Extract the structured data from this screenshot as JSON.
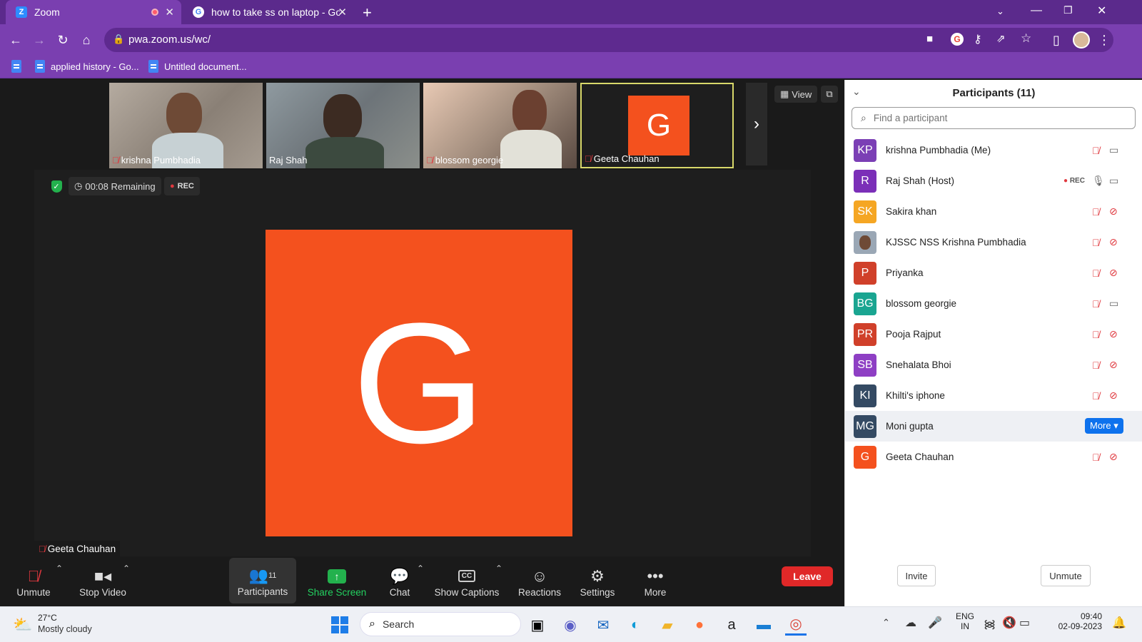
{
  "browser": {
    "tabs": [
      {
        "title": "Zoom",
        "favicon": "Z",
        "active": true
      },
      {
        "title": "how to take ss on laptop - Googl",
        "favicon": "G",
        "active": false
      }
    ],
    "new_tab": "+",
    "url": "pwa.zoom.us/wc/",
    "bookmarks": [
      "applied history - Go...",
      "Untitled document..."
    ]
  },
  "meeting": {
    "thumbnails": [
      {
        "name": "krishna Pumbhadia",
        "muted": true
      },
      {
        "name": "Raj Shah",
        "muted": false
      },
      {
        "name": "blossom georgie",
        "muted": true
      },
      {
        "name": "Geeta Chauhan",
        "muted": true,
        "initial": "G"
      }
    ],
    "view_label": "View",
    "timer": "00:08 Remaining",
    "rec": "REC",
    "main_initial": "G",
    "speaker_name": "Geeta Chauhan",
    "brand_color": "#f4511e"
  },
  "controls": {
    "unmute": "Unmute",
    "stop_video": "Stop Video",
    "participants": "Participants",
    "participants_count": "11",
    "share_screen": "Share Screen",
    "chat": "Chat",
    "show_captions": "Show Captions",
    "reactions": "Reactions",
    "settings": "Settings",
    "more": "More",
    "leave": "Leave"
  },
  "panel": {
    "title": "Participants (11)",
    "search_placeholder": "Find a participant",
    "participants": [
      {
        "initials": "KP",
        "name": "krishna Pumbhadia (Me)",
        "color": "#7b3fb5",
        "mic": "muted",
        "video": "on"
      },
      {
        "initials": "R",
        "name": "Raj Shah (Host)",
        "color": "#7b2fb8",
        "mic": "on",
        "video": "on",
        "rec": "REC"
      },
      {
        "initials": "SK",
        "name": "Sakira khan",
        "color": "#f5a623",
        "mic": "muted",
        "video": "off"
      },
      {
        "initials": "",
        "name": "KJSSC NSS Krishna Pumbhadia",
        "color": "#9aa7b5",
        "mic": "muted",
        "video": "off",
        "photo": true
      },
      {
        "initials": "P",
        "name": "Priyanka",
        "color": "#d0402a",
        "mic": "muted",
        "video": "off"
      },
      {
        "initials": "BG",
        "name": "blossom georgie",
        "color": "#1aa591",
        "mic": "muted",
        "video": "on"
      },
      {
        "initials": "PR",
        "name": "Pooja Rajput",
        "color": "#d0402a",
        "mic": "muted",
        "video": "off"
      },
      {
        "initials": "SB",
        "name": "Snehalata Bhoi",
        "color": "#8e3fc4",
        "mic": "muted",
        "video": "off"
      },
      {
        "initials": "KI",
        "name": "Khilti's iphone",
        "color": "#344a63",
        "mic": "muted",
        "video": "off"
      },
      {
        "initials": "MG",
        "name": "Moni gupta",
        "color": "#344a63",
        "mic": "none",
        "video": "none",
        "hover": true,
        "more_label": "More ▾"
      },
      {
        "initials": "G",
        "name": "Geeta Chauhan",
        "color": "#f4511e",
        "mic": "muted",
        "video": "off"
      }
    ],
    "invite": "Invite",
    "unmute_all": "Unmute"
  },
  "taskbar": {
    "temp": "27°C",
    "weather": "Mostly cloudy",
    "search": "Search",
    "lang1": "ENG",
    "lang2": "IN",
    "time": "09:40",
    "date": "02-09-2023"
  }
}
